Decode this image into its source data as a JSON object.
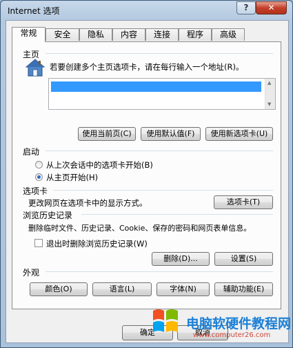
{
  "window": {
    "title": "Internet 选项",
    "help": "?",
    "close": "✕"
  },
  "tabs": [
    "常规",
    "安全",
    "隐私",
    "内容",
    "连接",
    "程序",
    "高级"
  ],
  "home": {
    "title": "主页",
    "description": "若要创建多个主页选项卡，请在每行输入一个地址(R)。",
    "btn_current": "使用当前页(C)",
    "btn_default": "使用默认值(F)",
    "btn_new_tab": "使用新选项卡(U)"
  },
  "startup": {
    "title": "启动",
    "opt_last_session": "从上次会话中的选项卡开始(B)",
    "opt_home": "从主页开始(H)",
    "selected": "opt_home"
  },
  "tabs_section": {
    "title": "选项卡",
    "description": "更改网页在选项卡中的显示方式。",
    "btn": "选项卡(T)"
  },
  "history": {
    "title": "浏览历史记录",
    "description": "删除临时文件、历史记录、Cookie、保存的密码和网页表单信息。",
    "checkbox": "退出时删除浏览历史记录(W)",
    "btn_delete": "删除(D)...",
    "btn_settings": "设置(S)"
  },
  "appearance": {
    "title": "外观",
    "btn_colors": "颜色(O)",
    "btn_languages": "语言(L)",
    "btn_fonts": "字体(N)",
    "btn_accessibility": "辅助功能(E)"
  },
  "footer": {
    "ok": "确定",
    "cancel": "取消"
  },
  "watermark": {
    "line1": "电脑软硬件教程网",
    "line2": "www.computer26.com"
  },
  "colors": {
    "accent": "#3399ff",
    "titlebar": "#b3c9e0",
    "panel": "#fcfcfc"
  }
}
